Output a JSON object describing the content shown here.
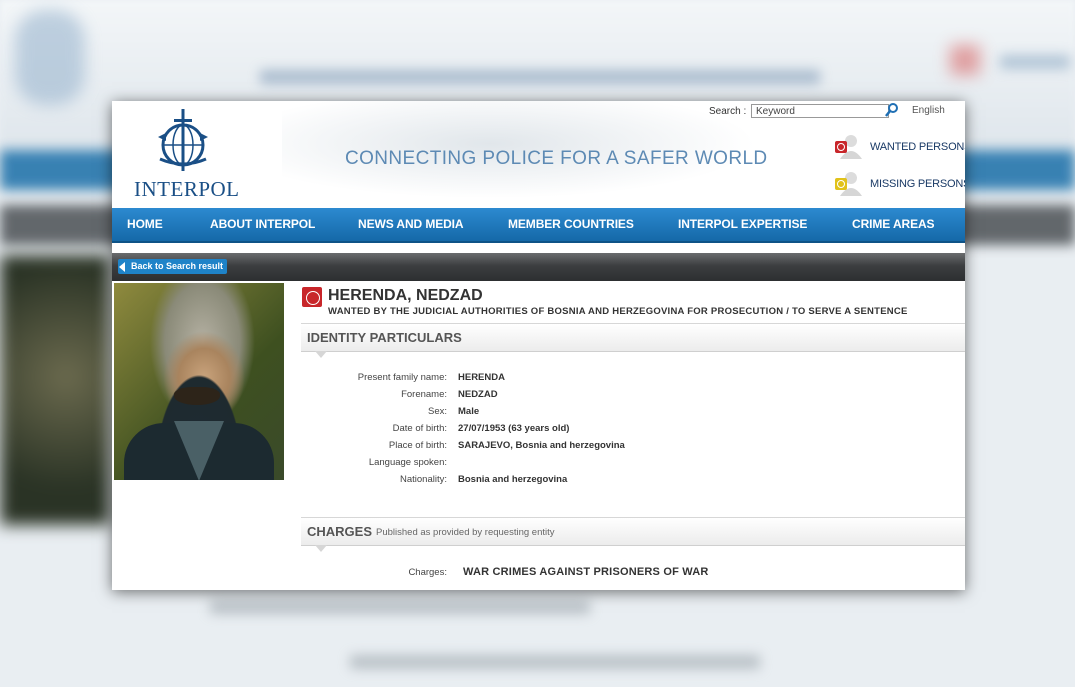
{
  "header": {
    "logo_text": "INTERPOL",
    "tagline": "CONNECTING POLICE FOR A SAFER WORLD",
    "search_label": "Search :",
    "search_placeholder": "Keyword",
    "language": "English",
    "quick_links": [
      {
        "label": "WANTED PERSONS",
        "icon": "wanted-persons-icon"
      },
      {
        "label": "MISSING PERSONS",
        "icon": "missing-persons-icon"
      }
    ]
  },
  "nav": {
    "items": [
      "HOME",
      "ABOUT INTERPOL",
      "NEWS AND MEDIA",
      "MEMBER COUNTRIES",
      "INTERPOL EXPERTISE",
      "CRIME AREAS"
    ]
  },
  "back_button": "Back to Search result",
  "notice": {
    "name": "HERENDA, NEDZAD",
    "wanted_by": "WANTED BY THE JUDICIAL AUTHORITIES OF BOSNIA AND HERZEGOVINA FOR PROSECUTION / TO SERVE A SENTENCE"
  },
  "identity": {
    "title": "IDENTITY PARTICULARS",
    "rows": [
      {
        "label": "Present family name:",
        "value": "HERENDA"
      },
      {
        "label": "Forename:",
        "value": "NEDZAD"
      },
      {
        "label": "Sex:",
        "value": "Male"
      },
      {
        "label": "Date of birth:",
        "value": "27/07/1953 (63 years old)"
      },
      {
        "label": "Place of birth:",
        "value": "SARAJEVO, Bosnia and herzegovina"
      },
      {
        "label": "Language spoken:",
        "value": ""
      },
      {
        "label": "Nationality:",
        "value": "Bosnia and herzegovina"
      }
    ]
  },
  "charges": {
    "title": "CHARGES",
    "subtitle": "Published as provided by requesting entity",
    "label": "Charges:",
    "value": "WAR CRIMES AGAINST PRISONERS OF WAR"
  },
  "colors": {
    "nav_blue": "#1f7cc0",
    "tagline_blue": "#5d8ab4",
    "logo_blue": "#1a4f86",
    "notice_red": "#c8262a"
  }
}
